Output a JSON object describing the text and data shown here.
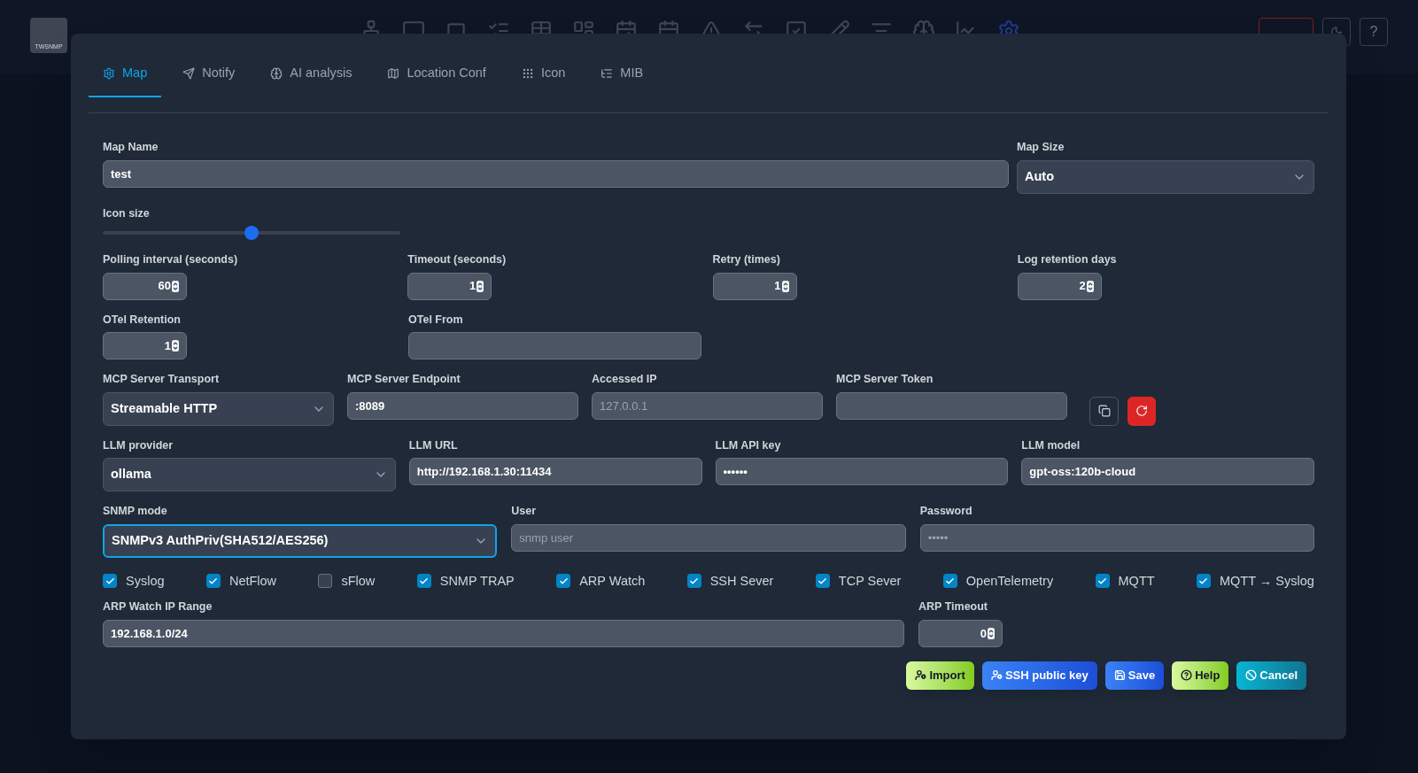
{
  "header": {
    "logo_text": "TWSNMP",
    "help_button": "?"
  },
  "tabs": [
    {
      "label": "Map",
      "selected": true
    },
    {
      "label": "Notify",
      "selected": false
    },
    {
      "label": "AI analysis",
      "selected": false
    },
    {
      "label": "Location Conf",
      "selected": false
    },
    {
      "label": "Icon",
      "selected": false
    },
    {
      "label": "MIB",
      "selected": false
    }
  ],
  "rows": [
    [
      {
        "kind": "text",
        "label": "Map Name",
        "value": "test"
      },
      {
        "kind": "select",
        "label": "Map Size",
        "value": "Auto",
        "focused": false
      }
    ],
    [
      {
        "kind": "slider",
        "label": "Icon size",
        "level": 0.5
      }
    ],
    [
      {
        "kind": "number",
        "label": "Polling interval (seconds)",
        "value": "60"
      },
      {
        "kind": "number",
        "label": "Timeout (seconds)",
        "value": "1"
      },
      {
        "kind": "number",
        "label": "Retry (times)",
        "value": "1"
      },
      {
        "kind": "number",
        "label": "Log retention days",
        "value": "2"
      }
    ],
    [
      {
        "kind": "number",
        "label": "OTel Retention",
        "value": "1"
      },
      {
        "kind": "text",
        "label": "OTel From"
      }
    ],
    [
      {
        "kind": "select",
        "label": "MCP Server Transport",
        "value": "Streamable HTTP",
        "focused": false
      },
      {
        "kind": "text",
        "label": "MCP Server Endpoint",
        "value": ":8089"
      },
      {
        "kind": "text",
        "label": "Accessed IP",
        "placeholder": "127.0.0.1"
      },
      {
        "kind": "text",
        "label": "MCP Server Token"
      }
    ],
    [
      {
        "kind": "select",
        "label": "LLM provider",
        "value": "ollama",
        "focused": false
      },
      {
        "kind": "text",
        "label": "LLM URL",
        "value": "http://192.168.1.30:11434"
      },
      {
        "kind": "text",
        "label": "LLM API key",
        "value": "••••••"
      },
      {
        "kind": "text",
        "label": "LLM model",
        "value": "gpt-oss:120b-cloud"
      }
    ],
    [
      {
        "kind": "select",
        "label": "SNMP mode",
        "value": "SNMPv3 AuthPriv(SHA512/AES256)",
        "focused": true
      },
      {
        "kind": "text",
        "label": "User",
        "placeholder": "snmp user"
      },
      {
        "kind": "text",
        "label": "Password",
        "placeholder": "•••••"
      }
    ]
  ],
  "checkboxes": [
    {
      "label": "Syslog",
      "checked": true
    },
    {
      "label": "NetFlow",
      "checked": true
    },
    {
      "label": "sFlow",
      "checked": false
    },
    {
      "label": "SNMP TRAP",
      "checked": true
    },
    {
      "label": "ARP Watch",
      "checked": true
    },
    {
      "label": "SSH Sever",
      "checked": true
    },
    {
      "label": "TCP Sever",
      "checked": true
    },
    {
      "label": "OpenTelemetry",
      "checked": true
    },
    {
      "label": "MQTT",
      "checked": true
    },
    {
      "label": "MQTT → Syslog",
      "checked": true
    }
  ],
  "arp_row": [
    {
      "kind": "text",
      "label": "ARP Watch IP Range",
      "value": "192.168.1.0/24"
    },
    {
      "kind": "number",
      "label": "ARP Timeout",
      "value": "0"
    }
  ],
  "buttons": [
    {
      "kind": "import",
      "label": "Import"
    },
    {
      "kind": "ssh",
      "label": "SSH public key"
    },
    {
      "kind": "save",
      "label": "Save"
    },
    {
      "kind": "help",
      "label": "Help"
    },
    {
      "kind": "cancel",
      "label": "Cancel"
    }
  ]
}
